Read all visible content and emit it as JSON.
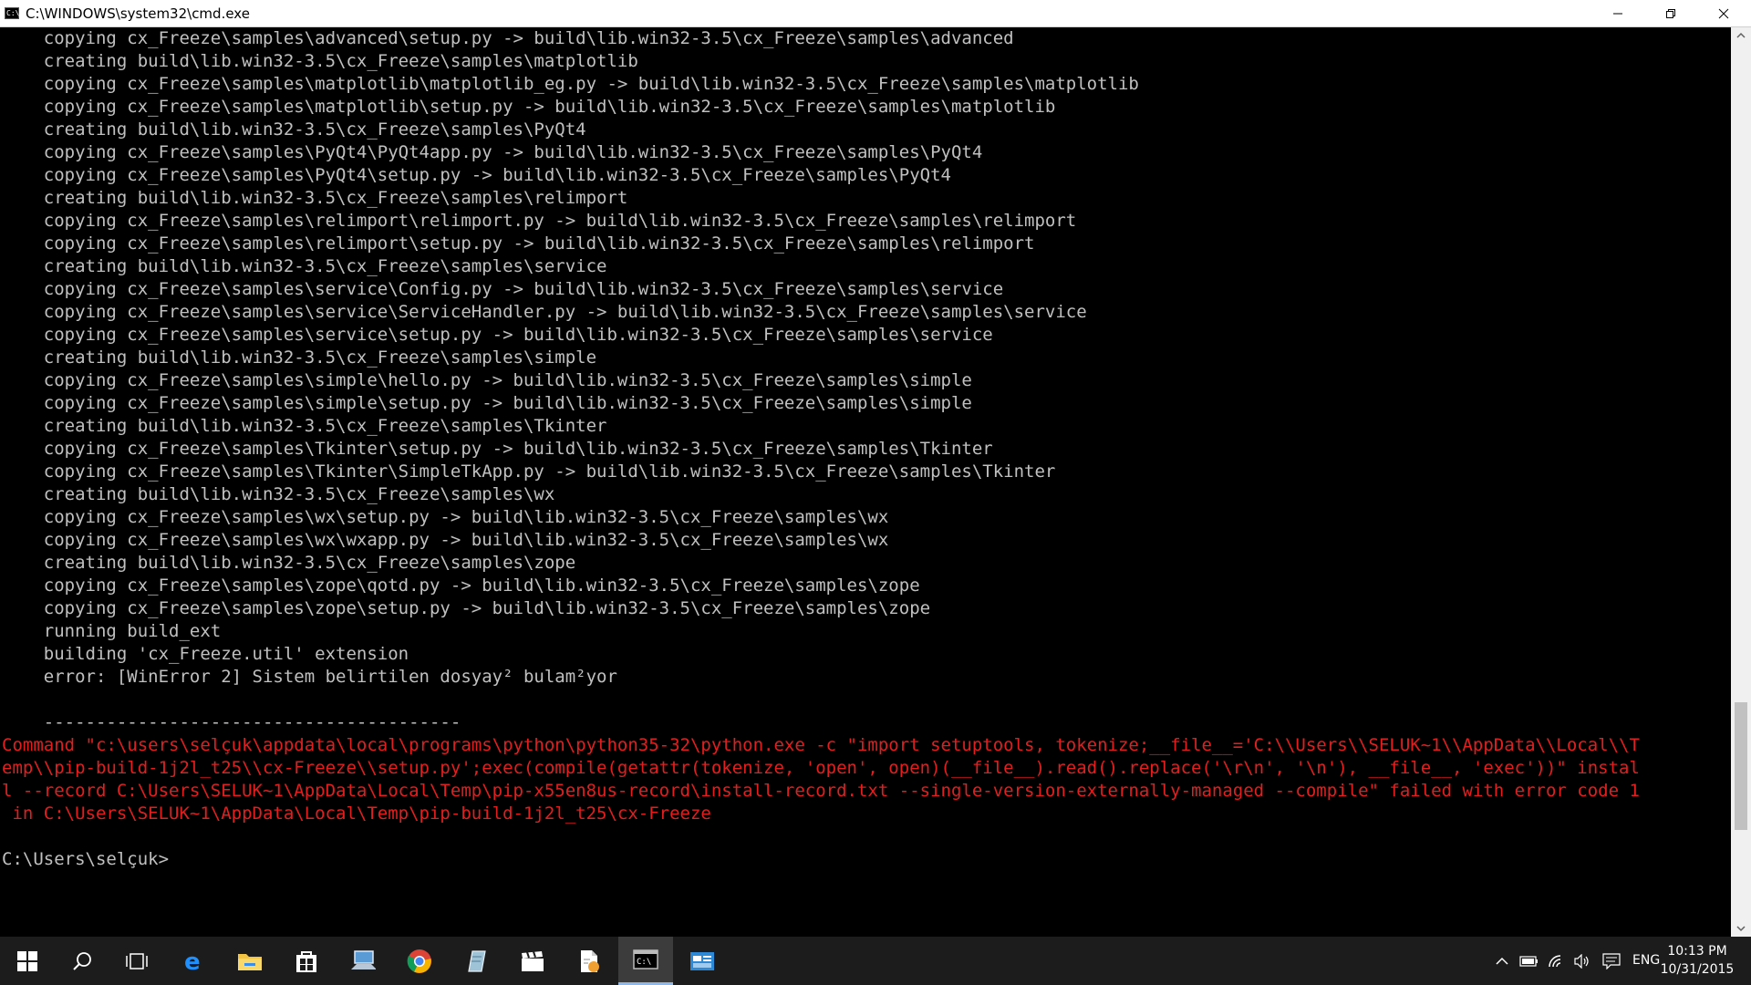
{
  "window": {
    "title": "C:\\WINDOWS\\system32\\cmd.exe",
    "icon_text": "C:\\"
  },
  "console": {
    "lines": [
      "    copying cx_Freeze\\samples\\advanced\\setup.py -> build\\lib.win32-3.5\\cx_Freeze\\samples\\advanced",
      "    creating build\\lib.win32-3.5\\cx_Freeze\\samples\\matplotlib",
      "    copying cx_Freeze\\samples\\matplotlib\\matplotlib_eg.py -> build\\lib.win32-3.5\\cx_Freeze\\samples\\matplotlib",
      "    copying cx_Freeze\\samples\\matplotlib\\setup.py -> build\\lib.win32-3.5\\cx_Freeze\\samples\\matplotlib",
      "    creating build\\lib.win32-3.5\\cx_Freeze\\samples\\PyQt4",
      "    copying cx_Freeze\\samples\\PyQt4\\PyQt4app.py -> build\\lib.win32-3.5\\cx_Freeze\\samples\\PyQt4",
      "    copying cx_Freeze\\samples\\PyQt4\\setup.py -> build\\lib.win32-3.5\\cx_Freeze\\samples\\PyQt4",
      "    creating build\\lib.win32-3.5\\cx_Freeze\\samples\\relimport",
      "    copying cx_Freeze\\samples\\relimport\\relimport.py -> build\\lib.win32-3.5\\cx_Freeze\\samples\\relimport",
      "    copying cx_Freeze\\samples\\relimport\\setup.py -> build\\lib.win32-3.5\\cx_Freeze\\samples\\relimport",
      "    creating build\\lib.win32-3.5\\cx_Freeze\\samples\\service",
      "    copying cx_Freeze\\samples\\service\\Config.py -> build\\lib.win32-3.5\\cx_Freeze\\samples\\service",
      "    copying cx_Freeze\\samples\\service\\ServiceHandler.py -> build\\lib.win32-3.5\\cx_Freeze\\samples\\service",
      "    copying cx_Freeze\\samples\\service\\setup.py -> build\\lib.win32-3.5\\cx_Freeze\\samples\\service",
      "    creating build\\lib.win32-3.5\\cx_Freeze\\samples\\simple",
      "    copying cx_Freeze\\samples\\simple\\hello.py -> build\\lib.win32-3.5\\cx_Freeze\\samples\\simple",
      "    copying cx_Freeze\\samples\\simple\\setup.py -> build\\lib.win32-3.5\\cx_Freeze\\samples\\simple",
      "    creating build\\lib.win32-3.5\\cx_Freeze\\samples\\Tkinter",
      "    copying cx_Freeze\\samples\\Tkinter\\setup.py -> build\\lib.win32-3.5\\cx_Freeze\\samples\\Tkinter",
      "    copying cx_Freeze\\samples\\Tkinter\\SimpleTkApp.py -> build\\lib.win32-3.5\\cx_Freeze\\samples\\Tkinter",
      "    creating build\\lib.win32-3.5\\cx_Freeze\\samples\\wx",
      "    copying cx_Freeze\\samples\\wx\\setup.py -> build\\lib.win32-3.5\\cx_Freeze\\samples\\wx",
      "    copying cx_Freeze\\samples\\wx\\wxapp.py -> build\\lib.win32-3.5\\cx_Freeze\\samples\\wx",
      "    creating build\\lib.win32-3.5\\cx_Freeze\\samples\\zope",
      "    copying cx_Freeze\\samples\\zope\\qotd.py -> build\\lib.win32-3.5\\cx_Freeze\\samples\\zope",
      "    copying cx_Freeze\\samples\\zope\\setup.py -> build\\lib.win32-3.5\\cx_Freeze\\samples\\zope",
      "    running build_ext",
      "    building 'cx_Freeze.util' extension",
      "    error: [WinError 2] Sistem belirtilen dosyay² bulam²yor",
      "",
      "    ----------------------------------------"
    ],
    "error_lines": [
      "Command \"c:\\users\\selçuk\\appdata\\local\\programs\\python\\python35-32\\python.exe -c \"import setuptools, tokenize;__file__='C:\\\\Users\\\\SELUK~1\\\\AppData\\\\Local\\\\T",
      "emp\\\\pip-build-1j2l_t25\\\\cx-Freeze\\\\setup.py';exec(compile(getattr(tokenize, 'open', open)(__file__).read().replace('\\r\\n', '\\n'), __file__, 'exec'))\" instal",
      "l --record C:\\Users\\SELUK~1\\AppData\\Local\\Temp\\pip-x55en8us-record\\install-record.txt --single-version-externally-managed --compile\" failed with error code 1",
      " in C:\\Users\\SELUK~1\\AppData\\Local\\Temp\\pip-build-1j2l_t25\\cx-Freeze"
    ],
    "prompt": "C:\\Users\\selçuk>"
  },
  "colors": {
    "console_text": "#c0c0c0",
    "error_text": "#e31e1e",
    "background": "#000000",
    "taskbar": "#1c1c1c"
  },
  "taskbar": {
    "buttons": [
      {
        "name": "start-button",
        "icon": "windows-logo-icon"
      },
      {
        "name": "search-button",
        "icon": "search-icon"
      },
      {
        "name": "task-view-button",
        "icon": "task-view-icon"
      },
      {
        "name": "edge-button",
        "icon": "edge-icon"
      },
      {
        "name": "file-explorer-button",
        "icon": "folder-icon"
      },
      {
        "name": "store-button",
        "icon": "store-icon"
      },
      {
        "name": "app-button-1",
        "icon": "monitor-app-icon"
      },
      {
        "name": "chrome-button",
        "icon": "chrome-icon"
      },
      {
        "name": "app-button-2",
        "icon": "notes-app-icon"
      },
      {
        "name": "app-button-3",
        "icon": "clapper-icon"
      },
      {
        "name": "app-button-4",
        "icon": "document-app-icon"
      },
      {
        "name": "cmd-button",
        "icon": "cmd-icon"
      },
      {
        "name": "app-button-5",
        "icon": "window-app-icon"
      }
    ],
    "tray": {
      "language": "ENG",
      "time": "10:13 PM",
      "date": "10/31/2015"
    }
  }
}
